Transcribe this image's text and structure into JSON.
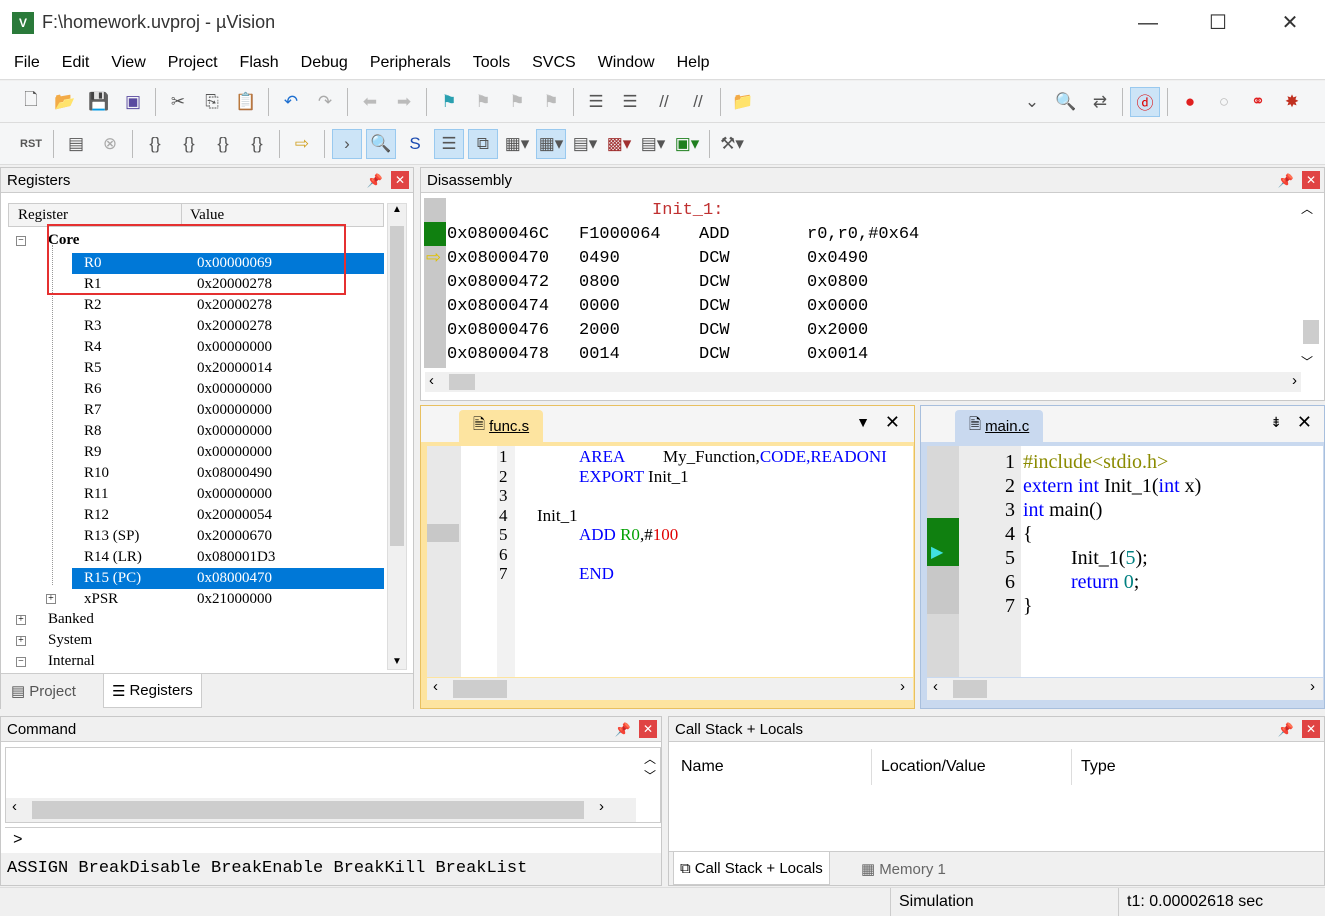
{
  "window": {
    "title": "F:\\homework.uvproj - µVision",
    "icon": "uv5-icon",
    "minimize": "—",
    "maximize": "☐",
    "close": "✕"
  },
  "menu": [
    "File",
    "Edit",
    "View",
    "Project",
    "Flash",
    "Debug",
    "Peripherals",
    "Tools",
    "SVCS",
    "Window",
    "Help"
  ],
  "registers": {
    "title": "Registers",
    "columns": [
      "Register",
      "Value"
    ],
    "group": "Core",
    "rows": [
      {
        "name": "R0",
        "value": "0x00000069",
        "selected": true
      },
      {
        "name": "R1",
        "value": "0x20000278"
      },
      {
        "name": "R2",
        "value": "0x20000278"
      },
      {
        "name": "R3",
        "value": "0x20000278"
      },
      {
        "name": "R4",
        "value": "0x00000000"
      },
      {
        "name": "R5",
        "value": "0x20000014"
      },
      {
        "name": "R6",
        "value": "0x00000000"
      },
      {
        "name": "R7",
        "value": "0x00000000"
      },
      {
        "name": "R8",
        "value": "0x00000000"
      },
      {
        "name": "R9",
        "value": "0x00000000"
      },
      {
        "name": "R10",
        "value": "0x08000490"
      },
      {
        "name": "R11",
        "value": "0x00000000"
      },
      {
        "name": "R12",
        "value": "0x20000054"
      },
      {
        "name": "R13 (SP)",
        "value": "0x20000670"
      },
      {
        "name": "R14 (LR)",
        "value": "0x080001D3"
      },
      {
        "name": "R15 (PC)",
        "value": "0x08000470",
        "selected": true
      },
      {
        "name": "xPSR",
        "value": "0x21000000"
      }
    ],
    "groups": [
      "Banked",
      "System",
      "Internal"
    ],
    "tabs": [
      "Project",
      "Registers"
    ]
  },
  "disassembly": {
    "title": "Disassembly",
    "label": "Init_1:",
    "rows": [
      {
        "addr": "0x0800046C",
        "code": "F1000064",
        "op": "ADD",
        "args": "r0,r0,#0x64"
      },
      {
        "addr": "0x08000470",
        "code": "0490",
        "op": "DCW",
        "args": "0x0490",
        "current": true
      },
      {
        "addr": "0x08000472",
        "code": "0800",
        "op": "DCW",
        "args": "0x0800"
      },
      {
        "addr": "0x08000474",
        "code": "0000",
        "op": "DCW",
        "args": "0x0000"
      },
      {
        "addr": "0x08000476",
        "code": "2000",
        "op": "DCW",
        "args": "0x2000"
      },
      {
        "addr": "0x08000478",
        "code": "0014",
        "op": "DCW",
        "args": "0x0014"
      }
    ]
  },
  "func_s": {
    "tab": "func.s",
    "lines": [
      "1",
      "2",
      "3",
      "4",
      "5",
      "6",
      "7"
    ],
    "code": {
      "l1a": "AREA",
      "l1b": "My_Function,",
      "l1c": "CODE,READONI",
      "l2a": "EXPORT",
      "l2b": " Init_1",
      "l4": "Init_1",
      "l5a": "ADD",
      "l5b": " R0",
      "l5c": ",#",
      "l5d": "100",
      "l7": "END"
    }
  },
  "main_c": {
    "tab": "main.c",
    "lines": [
      "1",
      "2",
      "3",
      "4",
      "5",
      "6",
      "7"
    ],
    "code": {
      "l1": "#include<stdio.h>",
      "l2a": "extern int",
      "l2b": " Init_1(",
      "l2c": "int",
      "l2d": " x)",
      "l3a": "int",
      "l3b": " main()",
      "l4": "{",
      "l5a": "Init_1(",
      "l5b": "5",
      "l5c": ");",
      "l6a": "return",
      "l6b": " 0",
      "l6c": ";",
      "l7": "}"
    }
  },
  "command": {
    "title": "Command",
    "prompt": ">",
    "hint": "ASSIGN BreakDisable BreakEnable BreakKill BreakList"
  },
  "callstack": {
    "title": "Call Stack + Locals",
    "columns": [
      "Name",
      "Location/Value",
      "Type"
    ],
    "tabs": [
      "Call Stack + Locals",
      "Memory 1"
    ]
  },
  "status": {
    "mode": "Simulation",
    "time": "t1: 0.00002618 sec"
  }
}
